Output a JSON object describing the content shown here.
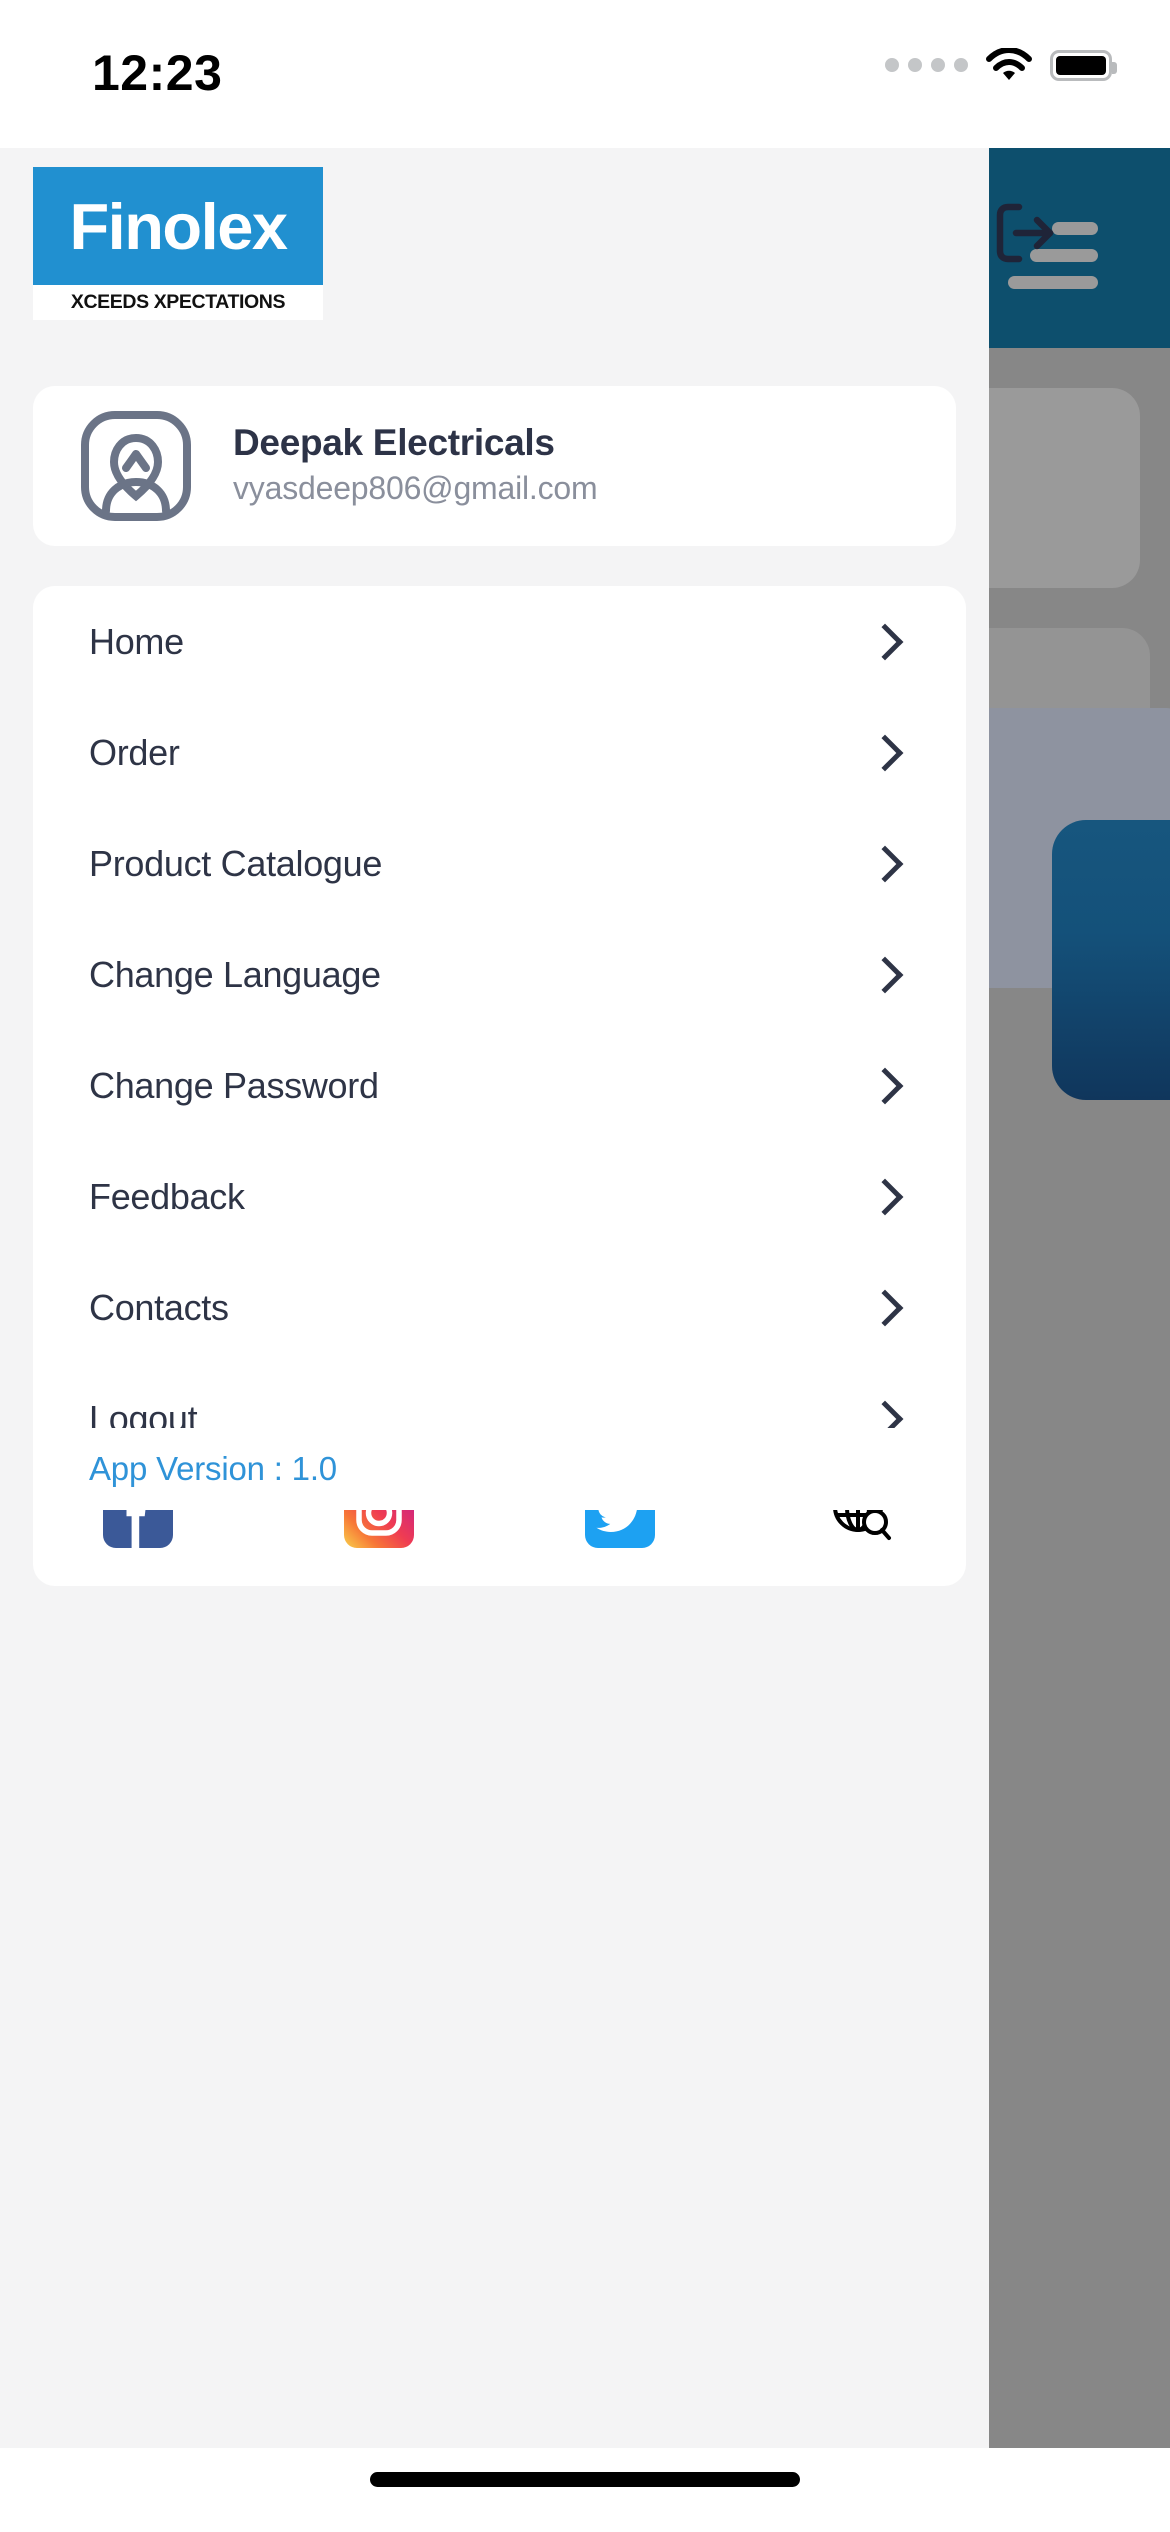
{
  "status_bar": {
    "time": "12:23",
    "signal_icon": "signal-dots-icon",
    "wifi_icon": "wifi-icon",
    "battery_icon": "battery-full-icon"
  },
  "drawer": {
    "logo": {
      "word": "Finolex",
      "tagline": "XCEEDS XPECTATIONS",
      "brand_color": "#2190d0"
    },
    "logout_icon": "logout-icon",
    "profile": {
      "avatar_icon": "user-avatar-icon",
      "name": "Deepak Electricals",
      "email": "vyasdeep806@gmail.com"
    },
    "menu": [
      {
        "label": "Home",
        "chevron": "chevron-right-icon"
      },
      {
        "label": "Order",
        "chevron": "chevron-right-icon"
      },
      {
        "label": "Product Catalogue",
        "chevron": "chevron-right-icon"
      },
      {
        "label": "Change Language",
        "chevron": "chevron-right-icon"
      },
      {
        "label": "Change Password",
        "chevron": "chevron-right-icon"
      },
      {
        "label": "Feedback",
        "chevron": "chevron-right-icon"
      },
      {
        "label": "Contacts",
        "chevron": "chevron-right-icon"
      },
      {
        "label": "Logout",
        "chevron": "chevron-right-icon"
      }
    ],
    "social": [
      {
        "name": "facebook",
        "icon": "facebook-icon",
        "color": "#3b5998"
      },
      {
        "name": "instagram",
        "icon": "instagram-icon",
        "color": "#d62976"
      },
      {
        "name": "twitter",
        "icon": "twitter-icon",
        "color": "#1da1f2"
      },
      {
        "name": "website",
        "icon": "globe-search-icon",
        "color": "#000000"
      }
    ],
    "version": "App Version : 1.0"
  },
  "background_screen": {
    "header_color": "#0d4f6d",
    "menu_icon": "hamburger-menu-icon",
    "overlay_color": "#878787"
  }
}
